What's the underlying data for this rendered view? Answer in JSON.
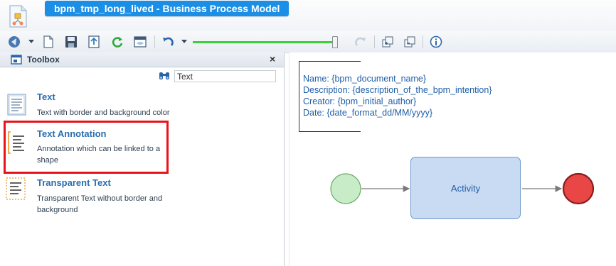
{
  "window": {
    "title": "bpm_tmp_long_lived - Business Process Model"
  },
  "toolbar": {
    "icons": [
      "navigator-icon",
      "new-document-icon",
      "save-icon",
      "export-icon",
      "refresh-icon",
      "preview-icon",
      "undo-icon",
      "zoom-slider",
      "redo-icon",
      "group-icon",
      "ungroup-icon",
      "info-icon"
    ],
    "zoom_level": 1.0
  },
  "toolbox": {
    "title": "Toolbox",
    "close_glyph": "×",
    "search": {
      "value": "Text",
      "placeholder": ""
    },
    "items": [
      {
        "name": "Text",
        "description": "Text with border and background color"
      },
      {
        "name": "Text Annotation",
        "description": "Annotation which can be linked to a shape"
      },
      {
        "name": "Transparent Text",
        "description": "Transparent Text without border and background"
      }
    ]
  },
  "canvas": {
    "annotation": {
      "line1": "Name: {bpm_document_name}",
      "line2": "Description: {description_of_the_bpm_intention}",
      "line3": "Creator: {bpm_initial_author}",
      "line4": "Date: {date_format_dd/MM/yyyy}"
    },
    "activity_label": "Activity",
    "colors": {
      "start_event": "#c8ecc8",
      "end_event": "#e94646",
      "activity_fill": "#c9dbf2",
      "text_blue": "#1f5fa8",
      "highlight": "#e8141b",
      "title_tab": "#1b8fe6"
    }
  }
}
